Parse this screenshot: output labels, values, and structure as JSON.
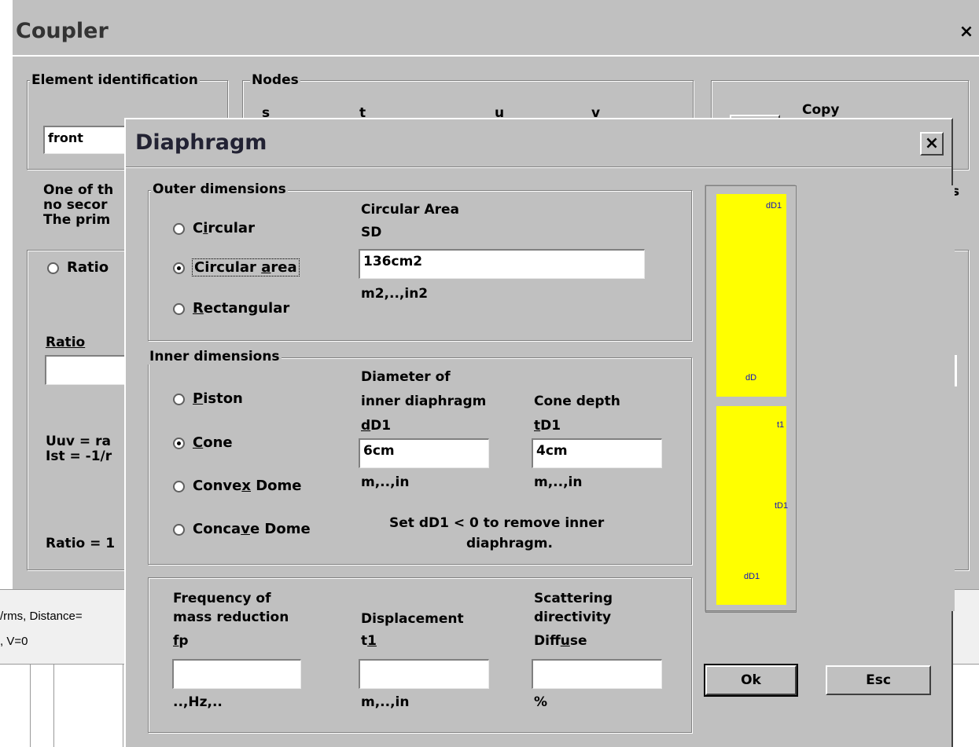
{
  "coupler": {
    "title": "Coupler",
    "element_identification": "Element identification",
    "element_id_value": "front",
    "nodes_title": "Nodes",
    "nodes": [
      "s",
      "t",
      "u",
      "v"
    ],
    "copy_label": "Copy",
    "partial_text_1": "One of th",
    "partial_text_2": "no secor",
    "partial_text_3": "The prim",
    "partial_right": "s",
    "ratio_radio": "Ratio",
    "ratio_label": "Ratio",
    "uuv_text": "Uuv = ra",
    "ist_text": "Ist = -1/r",
    "ratio_eq": "Ratio = 1",
    "status_1": "/rms, Distance=",
    "status_2": ", V=0"
  },
  "diaphragm": {
    "title": "Diaphragm",
    "outer": {
      "title": "Outer dimensions",
      "options": [
        "Circular",
        "Circular area",
        "Rectangular"
      ],
      "selected": "Circular area",
      "field_title": "Circular Area",
      "field_symbol": "SD",
      "value": "136cm2",
      "units": "m2,..,in2"
    },
    "inner": {
      "title": "Inner dimensions",
      "options": [
        "Piston",
        "Cone",
        "Convex Dome",
        "Concave Dome"
      ],
      "selected": "Cone",
      "diameter_label_1": "Diameter of",
      "diameter_label_2": "inner diaphragm",
      "diameter_symbol": "dD1",
      "diameter_value": "6cm",
      "diameter_units": "m,..,in",
      "depth_label": "Cone depth",
      "depth_symbol": "tD1",
      "depth_value": "4cm",
      "depth_units": "m,..,in",
      "note_1": "Set dD1 < 0 to remove inner",
      "note_2": "diaphragm."
    },
    "bottom": {
      "freq_label_1": "Frequency of",
      "freq_label_2": "mass reduction",
      "freq_symbol": "fp",
      "freq_value": "",
      "freq_units": "..,Hz,..",
      "disp_label": "Displacement",
      "disp_symbol": "t1",
      "disp_value": "",
      "disp_units": "m,..,in",
      "scat_label_1": "Scattering",
      "scat_label_2": "directivity",
      "scat_symbol": "Diffuse",
      "scat_value": "",
      "scat_units": "%"
    },
    "diagram_labels": {
      "dD1_top": "dD1",
      "dD": "dD",
      "t1": "t1",
      "tD1": "tD1",
      "dD1_bottom": "dD1"
    },
    "ok_label": "Ok",
    "esc_label": "Esc",
    "colors": {
      "yellow": "#ffff00",
      "maroon": "#800000",
      "dim_blue": "#1010c0"
    }
  }
}
